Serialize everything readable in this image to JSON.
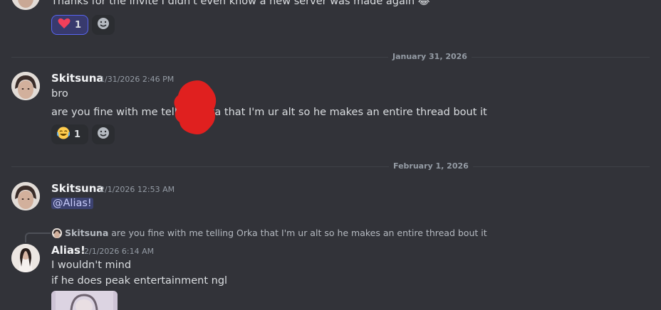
{
  "message0": {
    "text": "Thanks for the invite I didn't even know a new server was made again 😂",
    "reaction": {
      "emoji": "❤️",
      "count": "1"
    }
  },
  "divider1": {
    "label": "January 31, 2026"
  },
  "message1": {
    "username": "Skitsuna",
    "timestamp": "1/31/2026 2:46 PM",
    "line1": "bro",
    "line2": "are you fine with me telling Orka that I'm ur alt so he makes an entire thread bout it",
    "reaction": {
      "emoji": "😂",
      "count": "1"
    }
  },
  "divider2": {
    "label": "February 1, 2026"
  },
  "message2": {
    "username": "Skitsuna",
    "timestamp": "2/1/2026 12:53 AM",
    "mention": "@Alias!"
  },
  "message3": {
    "reply": {
      "username": "Skitsuna",
      "text": "are you fine with me telling Orka that I'm ur alt so he makes an entire thread bout it"
    },
    "username": "Alias!",
    "timestamp": "2/1/2026 6:14 AM",
    "line1": "I wouldn't mind",
    "line2": "if he does peak entertainment ngl"
  },
  "colors": {
    "background": "#323339",
    "mention_bg": "#3c4270",
    "redaction": "#e0201f",
    "reaction_mine_border": "#5865f2"
  }
}
